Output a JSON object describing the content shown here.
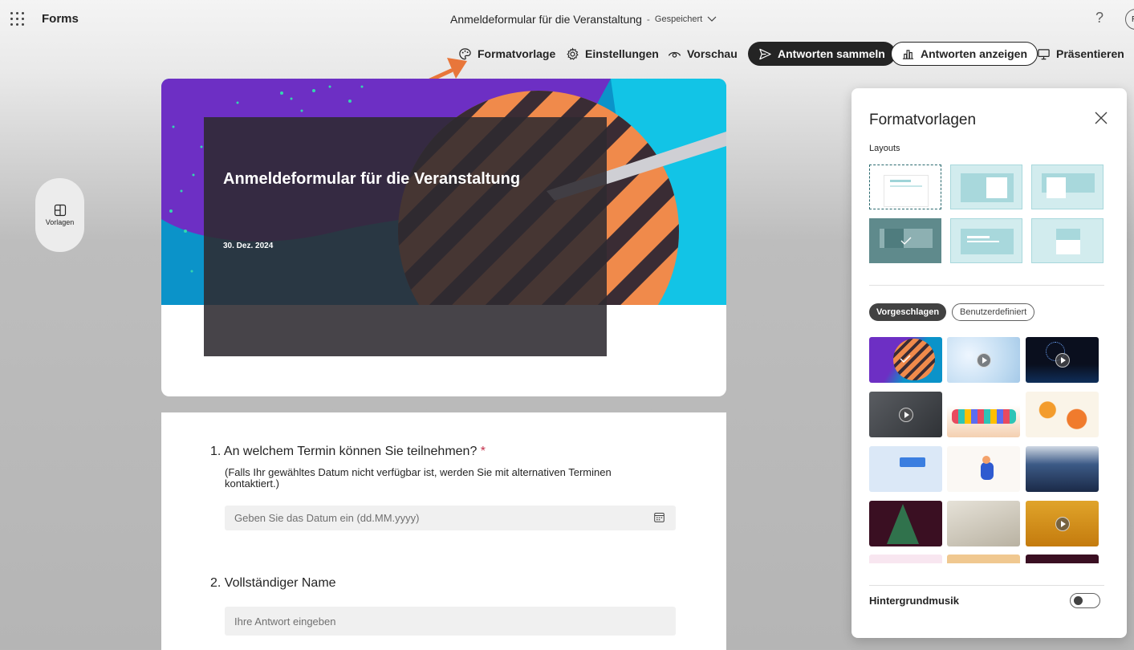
{
  "header": {
    "app_name": "Forms",
    "doc_title": "Anmeldeformular für die Veranstaltung",
    "separator": "-",
    "save_status": "Gespeichert",
    "help": "?",
    "avatar": "R"
  },
  "toolbar": {
    "style": "Formatvorlage",
    "settings": "Einstellungen",
    "preview": "Vorschau",
    "collect": "Antworten sammeln",
    "responses": "Antworten anzeigen",
    "present": "Präsentieren"
  },
  "left_rail": {
    "templates": "Vorlagen"
  },
  "form": {
    "title": "Anmeldeformular für die Veranstaltung",
    "date": "30. Dez. 2024",
    "questions": [
      {
        "number": "1.",
        "text": "An welchem Termin können Sie teilnehmen?",
        "required_mark": "*",
        "subtitle": "(Falls Ihr gewähltes Datum nicht verfügbar ist, werden Sie mit alternativen Terminen kontaktiert.)",
        "placeholder": "Geben Sie das Datum ein (dd.MM.yyyy)"
      },
      {
        "number": "2.",
        "text": "Vollständiger Name",
        "placeholder": "Ihre Antwort eingeben"
      }
    ]
  },
  "style_panel": {
    "title": "Formatvorlagen",
    "layouts_label": "Layouts",
    "tab_suggested": "Vorgeschlagen",
    "tab_custom": "Benutzerdefiniert",
    "music_label": "Hintergrundmusik",
    "music_enabled": false,
    "selected_layout": 4,
    "selected_theme": 1,
    "themes": [
      "abstract-stripes",
      "snow-bokeh-video",
      "ferris-wheel-night-video",
      "chalkboard-video",
      "colorful-hands",
      "peaches",
      "rating-stars",
      "person-illustration",
      "skyscrapers",
      "christmas-tree",
      "cozy-room",
      "birthday-cake-video"
    ]
  },
  "colors": {
    "dark_button": "#242424",
    "accent_teal": "#d2ecee",
    "required": "#c4314b",
    "arrow": "#e8763a"
  }
}
